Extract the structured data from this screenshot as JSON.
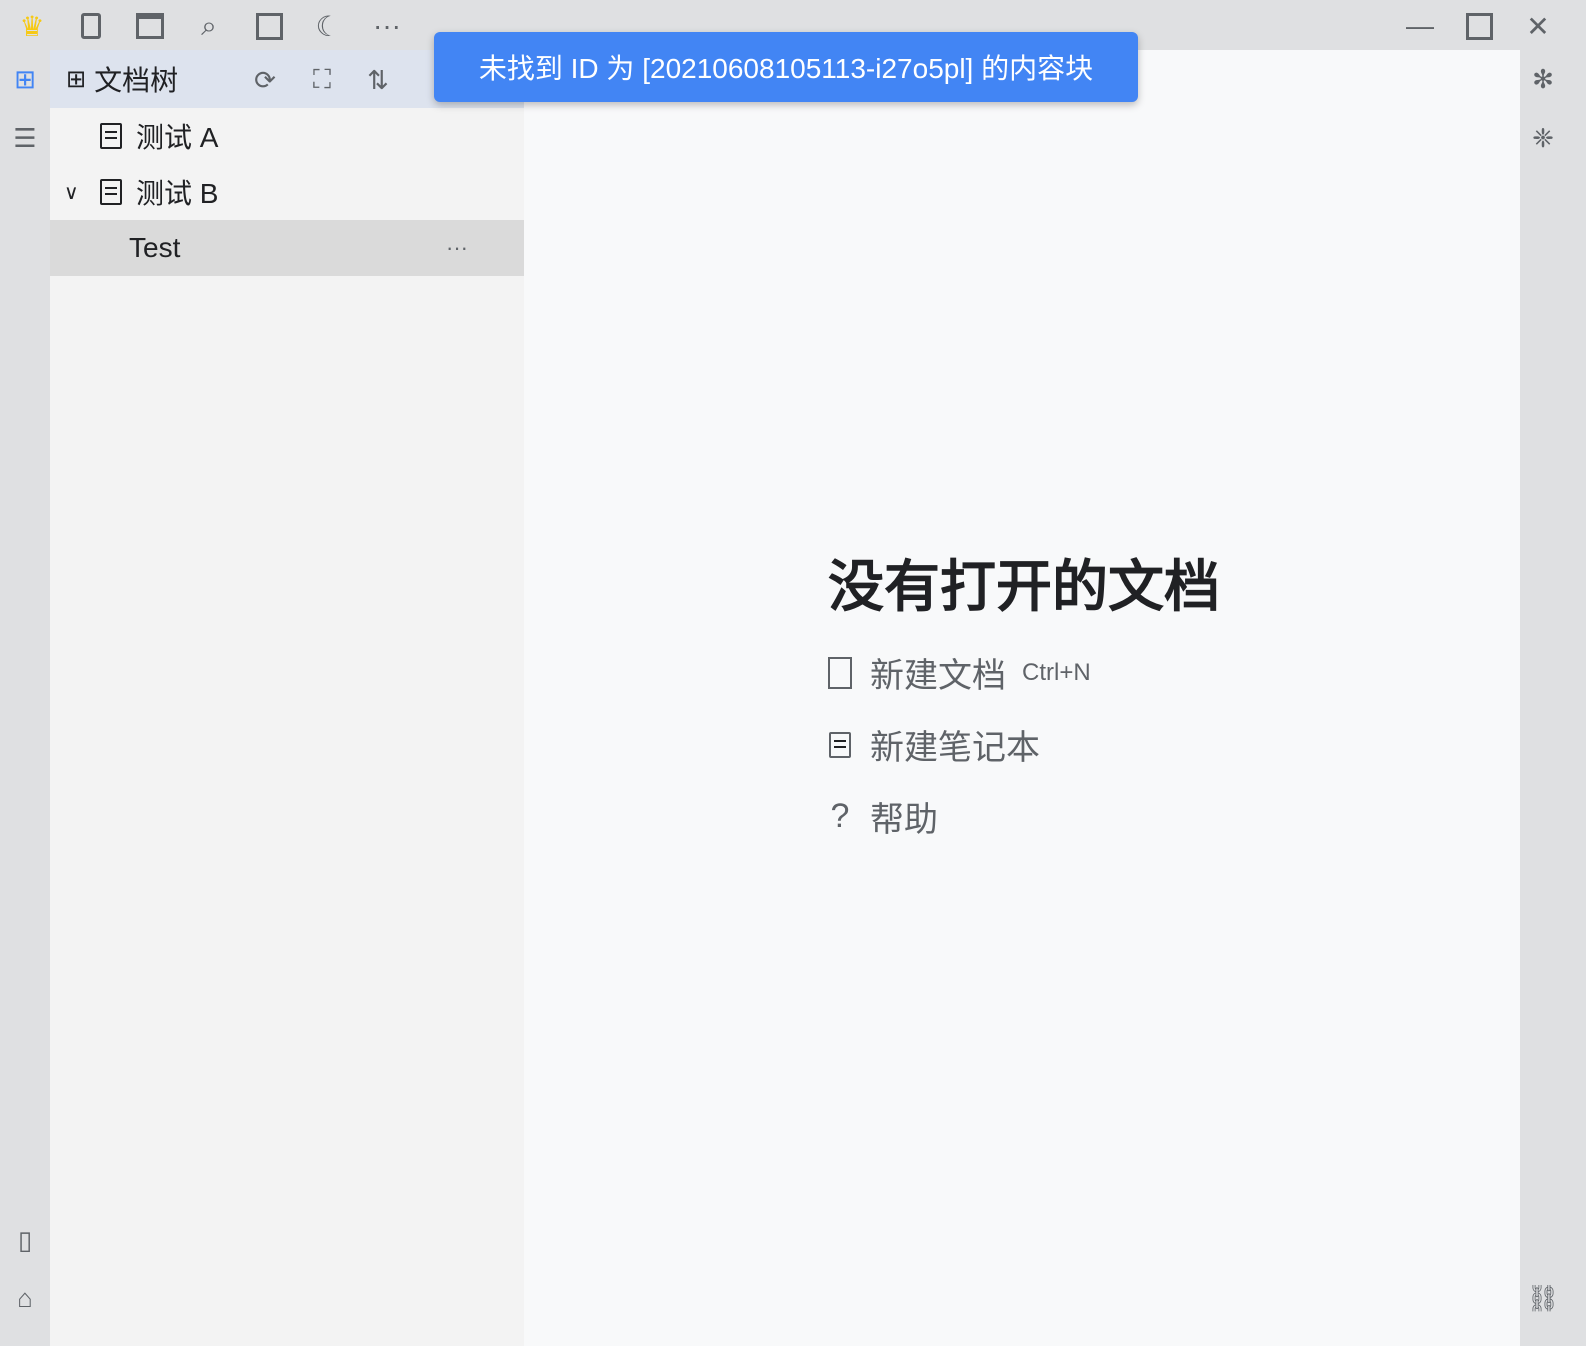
{
  "toolbar": {
    "icons": [
      "crown-icon",
      "files-icon",
      "calendar-icon",
      "search-icon",
      "square-icon",
      "moon-icon",
      "more-icon"
    ]
  },
  "window": {
    "minimize": "—",
    "close": "✕"
  },
  "panel": {
    "title": "文档树",
    "items": [
      {
        "label": "测试 A"
      },
      {
        "label": "测试 B"
      },
      {
        "label": "Test"
      }
    ],
    "more": "···"
  },
  "toast": {
    "message": "未找到 ID 为 [20210608105113-i27o5pl] 的内容块",
    "color": "#4285f4"
  },
  "main": {
    "title": "没有打开的文档",
    "actions": [
      {
        "label": "新建文档",
        "shortcut": "Ctrl+N"
      },
      {
        "label": "新建笔记本"
      },
      {
        "label": "帮助"
      }
    ]
  }
}
